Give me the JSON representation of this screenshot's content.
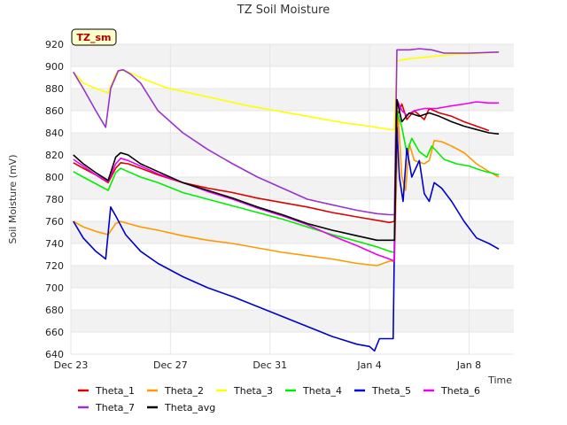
{
  "chart_data": {
    "type": "line",
    "title": "TZ Soil Moisture",
    "xlabel": "Time",
    "ylabel": "Soil Moisture (mV)",
    "badge": "TZ_sm",
    "ylim": [
      640,
      920
    ],
    "xlim": [
      0,
      17.8
    ],
    "yticks": [
      640,
      660,
      680,
      700,
      720,
      740,
      760,
      780,
      800,
      820,
      840,
      860,
      880,
      900,
      920
    ],
    "xticks": [
      {
        "value": 0,
        "label": "Dec 23"
      },
      {
        "value": 4,
        "label": "Dec 27"
      },
      {
        "value": 8,
        "label": "Dec 31"
      },
      {
        "value": 12,
        "label": "Jan 4"
      },
      {
        "value": 16,
        "label": "Jan 8"
      }
    ],
    "grid": "horizontal bands",
    "legend_position": "bottom",
    "series": [
      {
        "name": "Theta_1",
        "color": "#dd0000",
        "points": [
          [
            0.1,
            813
          ],
          [
            0.5,
            808
          ],
          [
            1.0,
            802
          ],
          [
            1.5,
            795
          ],
          [
            1.8,
            808
          ],
          [
            2.0,
            813
          ],
          [
            2.3,
            812
          ],
          [
            2.8,
            808
          ],
          [
            3.5,
            802
          ],
          [
            4.5,
            795
          ],
          [
            5.5,
            790
          ],
          [
            6.5,
            786
          ],
          [
            7.5,
            781
          ],
          [
            8.5,
            777
          ],
          [
            9.5,
            773
          ],
          [
            10.5,
            768
          ],
          [
            11.5,
            764
          ],
          [
            12.3,
            761
          ],
          [
            12.8,
            759
          ],
          [
            13.0,
            760
          ],
          [
            13.1,
            855
          ],
          [
            13.3,
            866
          ],
          [
            13.5,
            852
          ],
          [
            13.8,
            860
          ],
          [
            14.2,
            852
          ],
          [
            14.4,
            862
          ],
          [
            14.8,
            858
          ],
          [
            15.3,
            855
          ],
          [
            15.8,
            850
          ],
          [
            16.3,
            846
          ],
          [
            16.8,
            842
          ]
        ]
      },
      {
        "name": "Theta_2",
        "color": "#ff9900",
        "points": [
          [
            0.1,
            760
          ],
          [
            0.5,
            755
          ],
          [
            1.0,
            751
          ],
          [
            1.5,
            748
          ],
          [
            1.8,
            758
          ],
          [
            2.0,
            760
          ],
          [
            2.3,
            758
          ],
          [
            2.8,
            755
          ],
          [
            3.5,
            752
          ],
          [
            4.5,
            747
          ],
          [
            5.5,
            743
          ],
          [
            6.5,
            740
          ],
          [
            7.5,
            736
          ],
          [
            8.5,
            732
          ],
          [
            9.5,
            729
          ],
          [
            10.5,
            726
          ],
          [
            11.5,
            722
          ],
          [
            12.3,
            720
          ],
          [
            12.8,
            724
          ],
          [
            13.0,
            724
          ],
          [
            13.15,
            855
          ],
          [
            13.3,
            800
          ],
          [
            13.45,
            788
          ],
          [
            13.6,
            830
          ],
          [
            13.8,
            815
          ],
          [
            14.2,
            812
          ],
          [
            14.4,
            815
          ],
          [
            14.6,
            833
          ],
          [
            14.9,
            832
          ],
          [
            15.3,
            828
          ],
          [
            15.8,
            822
          ],
          [
            16.3,
            812
          ],
          [
            16.8,
            805
          ],
          [
            17.2,
            800
          ]
        ]
      },
      {
        "name": "Theta_3",
        "color": "#ffff00",
        "points": [
          [
            0.1,
            895
          ],
          [
            0.5,
            885
          ],
          [
            1.0,
            880
          ],
          [
            1.5,
            876
          ],
          [
            1.8,
            893
          ],
          [
            2.0,
            897
          ],
          [
            2.3,
            895
          ],
          [
            3.0,
            888
          ],
          [
            3.8,
            881
          ],
          [
            5.0,
            875
          ],
          [
            6.0,
            870
          ],
          [
            7.0,
            865
          ],
          [
            8.0,
            861
          ],
          [
            9.0,
            857
          ],
          [
            10.0,
            853
          ],
          [
            11.0,
            849
          ],
          [
            12.0,
            846
          ],
          [
            12.8,
            843
          ],
          [
            13.0,
            843
          ],
          [
            13.1,
            905
          ],
          [
            13.6,
            907
          ],
          [
            14.5,
            909
          ],
          [
            15.5,
            911
          ],
          [
            16.5,
            912
          ],
          [
            17.2,
            913
          ]
        ]
      },
      {
        "name": "Theta_4",
        "color": "#00ee00",
        "points": [
          [
            0.1,
            805
          ],
          [
            0.5,
            800
          ],
          [
            1.0,
            794
          ],
          [
            1.5,
            788
          ],
          [
            1.8,
            804
          ],
          [
            2.0,
            808
          ],
          [
            2.3,
            805
          ],
          [
            2.8,
            800
          ],
          [
            3.5,
            795
          ],
          [
            4.5,
            786
          ],
          [
            5.5,
            780
          ],
          [
            6.5,
            774
          ],
          [
            7.5,
            768
          ],
          [
            8.5,
            762
          ],
          [
            9.5,
            755
          ],
          [
            10.5,
            748
          ],
          [
            11.5,
            742
          ],
          [
            12.3,
            737
          ],
          [
            12.8,
            733
          ],
          [
            13.0,
            732
          ],
          [
            13.1,
            860
          ],
          [
            13.3,
            845
          ],
          [
            13.5,
            822
          ],
          [
            13.7,
            835
          ],
          [
            14.0,
            823
          ],
          [
            14.3,
            818
          ],
          [
            14.5,
            828
          ],
          [
            15.0,
            816
          ],
          [
            15.5,
            812
          ],
          [
            16.0,
            810
          ],
          [
            16.5,
            806
          ],
          [
            17.2,
            802
          ]
        ]
      },
      {
        "name": "Theta_5",
        "color": "#0000cc",
        "points": [
          [
            0.1,
            760
          ],
          [
            0.5,
            745
          ],
          [
            1.0,
            733
          ],
          [
            1.4,
            726
          ],
          [
            1.6,
            773
          ],
          [
            1.8,
            765
          ],
          [
            2.2,
            748
          ],
          [
            2.8,
            733
          ],
          [
            3.5,
            722
          ],
          [
            4.5,
            710
          ],
          [
            5.5,
            700
          ],
          [
            6.5,
            692
          ],
          [
            7.5,
            683
          ],
          [
            8.5,
            674
          ],
          [
            9.5,
            665
          ],
          [
            10.5,
            656
          ],
          [
            11.5,
            649
          ],
          [
            12.0,
            647
          ],
          [
            12.2,
            643
          ],
          [
            12.4,
            654
          ],
          [
            12.8,
            654
          ],
          [
            12.95,
            654
          ],
          [
            13.0,
            740
          ],
          [
            13.1,
            845
          ],
          [
            13.2,
            800
          ],
          [
            13.35,
            778
          ],
          [
            13.5,
            826
          ],
          [
            13.7,
            800
          ],
          [
            14.0,
            815
          ],
          [
            14.2,
            785
          ],
          [
            14.4,
            778
          ],
          [
            14.6,
            795
          ],
          [
            14.9,
            790
          ],
          [
            15.3,
            778
          ],
          [
            15.8,
            760
          ],
          [
            16.3,
            745
          ],
          [
            16.8,
            740
          ],
          [
            17.2,
            735
          ]
        ]
      },
      {
        "name": "Theta_6",
        "color": "#ee00ee",
        "points": [
          [
            0.1,
            816
          ],
          [
            0.5,
            810
          ],
          [
            1.0,
            802
          ],
          [
            1.5,
            796
          ],
          [
            1.8,
            812
          ],
          [
            2.0,
            817
          ],
          [
            2.3,
            815
          ],
          [
            2.8,
            810
          ],
          [
            3.5,
            803
          ],
          [
            4.5,
            795
          ],
          [
            5.5,
            787
          ],
          [
            6.5,
            780
          ],
          [
            7.5,
            772
          ],
          [
            8.5,
            765
          ],
          [
            9.5,
            757
          ],
          [
            10.5,
            747
          ],
          [
            11.5,
            738
          ],
          [
            12.3,
            730
          ],
          [
            12.8,
            726
          ],
          [
            13.0,
            724
          ],
          [
            13.1,
            870
          ],
          [
            13.3,
            860
          ],
          [
            13.5,
            856
          ],
          [
            13.8,
            860
          ],
          [
            14.2,
            862
          ],
          [
            14.7,
            862
          ],
          [
            15.2,
            864
          ],
          [
            15.8,
            866
          ],
          [
            16.3,
            868
          ],
          [
            16.8,
            867
          ],
          [
            17.2,
            867
          ]
        ]
      },
      {
        "name": "Theta_7",
        "color": "#9933cc",
        "points": [
          [
            0.1,
            895
          ],
          [
            0.5,
            880
          ],
          [
            1.0,
            860
          ],
          [
            1.4,
            845
          ],
          [
            1.6,
            880
          ],
          [
            1.9,
            896
          ],
          [
            2.1,
            897
          ],
          [
            2.4,
            893
          ],
          [
            2.8,
            885
          ],
          [
            3.5,
            860
          ],
          [
            4.5,
            840
          ],
          [
            5.5,
            825
          ],
          [
            6.5,
            812
          ],
          [
            7.5,
            800
          ],
          [
            8.5,
            790
          ],
          [
            9.5,
            780
          ],
          [
            10.5,
            775
          ],
          [
            11.5,
            770
          ],
          [
            12.3,
            767
          ],
          [
            12.8,
            766
          ],
          [
            13.0,
            766
          ],
          [
            13.1,
            915
          ],
          [
            13.6,
            915
          ],
          [
            14.0,
            916
          ],
          [
            14.5,
            915
          ],
          [
            15.0,
            912
          ],
          [
            16.0,
            912
          ],
          [
            17.2,
            913
          ]
        ]
      },
      {
        "name": "Theta_avg",
        "color": "#000000",
        "points": [
          [
            0.1,
            820
          ],
          [
            0.5,
            812
          ],
          [
            1.0,
            804
          ],
          [
            1.5,
            797
          ],
          [
            1.8,
            818
          ],
          [
            2.0,
            822
          ],
          [
            2.3,
            820
          ],
          [
            2.8,
            812
          ],
          [
            3.5,
            805
          ],
          [
            4.5,
            795
          ],
          [
            5.5,
            788
          ],
          [
            6.5,
            781
          ],
          [
            7.5,
            773
          ],
          [
            8.5,
            766
          ],
          [
            9.5,
            758
          ],
          [
            10.5,
            752
          ],
          [
            11.5,
            747
          ],
          [
            12.3,
            743
          ],
          [
            12.8,
            743
          ],
          [
            13.0,
            743
          ],
          [
            13.1,
            870
          ],
          [
            13.3,
            850
          ],
          [
            13.6,
            858
          ],
          [
            14.0,
            855
          ],
          [
            14.4,
            858
          ],
          [
            14.8,
            855
          ],
          [
            15.3,
            850
          ],
          [
            15.8,
            846
          ],
          [
            16.3,
            843
          ],
          [
            16.8,
            840
          ],
          [
            17.2,
            839
          ]
        ]
      }
    ]
  }
}
